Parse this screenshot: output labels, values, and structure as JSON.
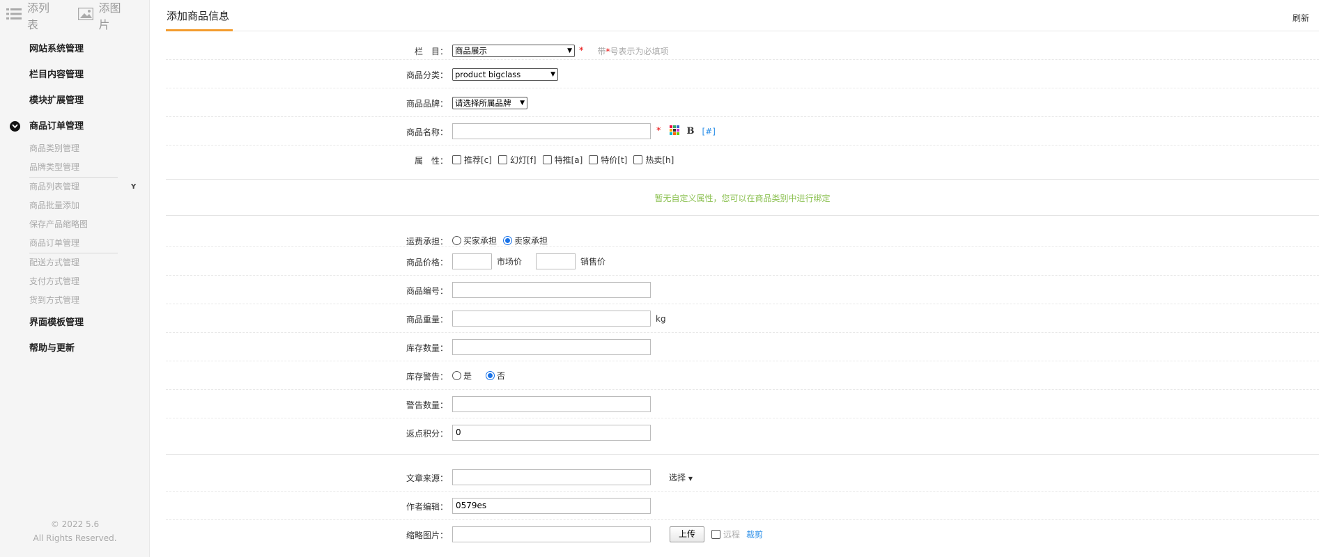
{
  "sidebar": {
    "tools": [
      {
        "label": "添列表",
        "icon": "list-icon"
      },
      {
        "label": "添图片",
        "icon": "image-icon"
      }
    ],
    "menu": {
      "site": "网站系统管理",
      "column": "栏目内容管理",
      "module": "模块扩展管理",
      "order": "商品订单管理",
      "template": "界面模板管理",
      "help": "帮助与更新"
    },
    "subs": [
      "商品类别管理",
      "品牌类型管理",
      "商品列表管理",
      "商品批量添加",
      "保存产品缩略图",
      "商品订单管理",
      "配送方式管理",
      "支付方式管理",
      "货到方式管理"
    ],
    "y_mark": "Y",
    "copyright": [
      "© 2022 5.6",
      "All Rights Reserved."
    ]
  },
  "header": {
    "tab": "添加商品信息",
    "refresh": "刷新"
  },
  "form": {
    "column": {
      "label": "栏　目：",
      "value": "商品展示",
      "hint_pre": "带",
      "hint_star": "*",
      "hint_post": "号表示为必填项"
    },
    "category": {
      "label": "商品分类：",
      "value": "product bigclass"
    },
    "brand": {
      "label": "商品品牌：",
      "value": "请选择所属品牌"
    },
    "name": {
      "label": "商品名称：",
      "value": "",
      "bold": "B",
      "anchor": "[#]"
    },
    "attrs": {
      "label": "属　性：",
      "options": [
        "推荐[c]",
        "幻灯[f]",
        "特推[a]",
        "特价[t]",
        "热卖[h]"
      ]
    },
    "custom_note": "暂无自定义属性，您可以在商品类别中进行绑定",
    "shipping": {
      "label": "运费承担：",
      "options": [
        "买家承担",
        "卖家承担"
      ],
      "selected": "卖家承担"
    },
    "price": {
      "label": "商品价格：",
      "market": "市场价",
      "sale": "销售价"
    },
    "sku": {
      "label": "商品编号：",
      "value": ""
    },
    "weight": {
      "label": "商品重量：",
      "value": "",
      "unit": "kg"
    },
    "stock": {
      "label": "库存数量：",
      "value": ""
    },
    "warn": {
      "label": "库存警告：",
      "options": [
        "是",
        "否"
      ],
      "selected": "否"
    },
    "warn_qty": {
      "label": "警告数量：",
      "value": ""
    },
    "points": {
      "label": "返点积分：",
      "value": "0"
    },
    "source": {
      "label": "文章来源：",
      "value": "",
      "choose": "选择"
    },
    "author": {
      "label": "作者编辑：",
      "value": "0579es"
    },
    "thumb": {
      "label": "缩略图片：",
      "value": "",
      "upload": "上传",
      "remote": "远程",
      "crop": "裁剪"
    }
  },
  "colors": {
    "accent": "#f39c2f",
    "required": "#e60000",
    "note": "#8cc152",
    "link": "#2b8fe8"
  }
}
